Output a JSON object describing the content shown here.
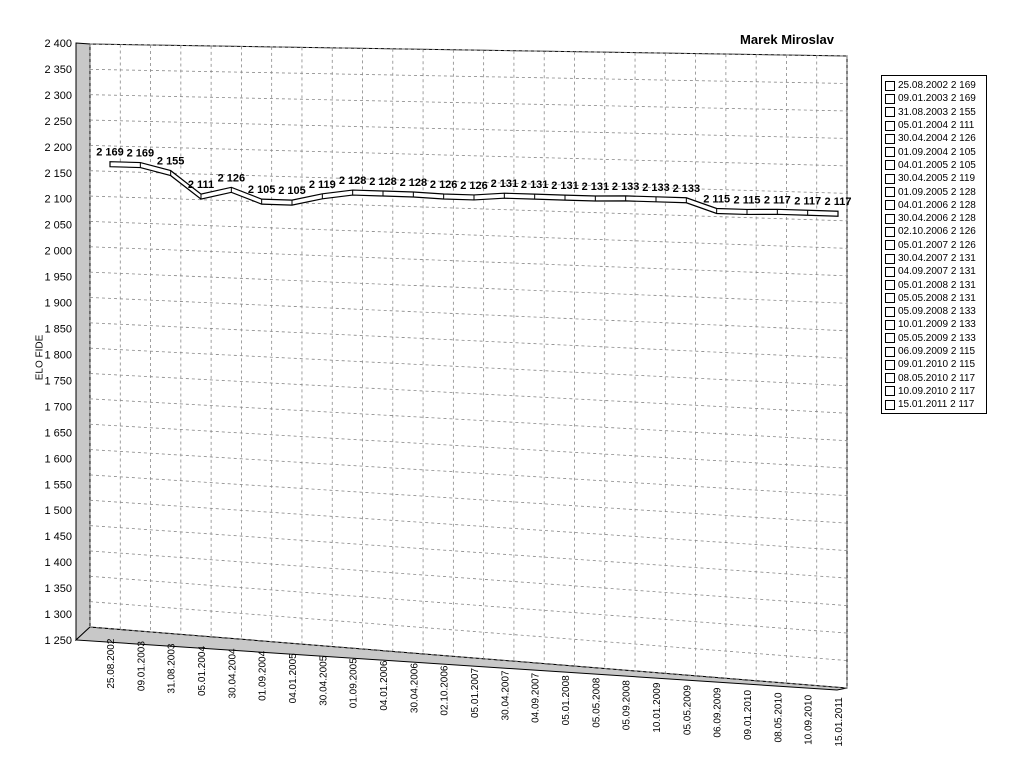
{
  "chart_data": {
    "type": "line",
    "title": "Marek Miroslav",
    "ylabel": "ELO FIDE",
    "xlabel": "",
    "ylim": [
      1250,
      2400
    ],
    "yticks": [
      "2 400",
      "2 350",
      "2 300",
      "2 250",
      "2 200",
      "2 150",
      "2 100",
      "2 050",
      "2 000",
      "1 950",
      "1 900",
      "1 850",
      "1 800",
      "1 750",
      "1 700",
      "1 650",
      "1 600",
      "1 550",
      "1 500",
      "1 450",
      "1 400",
      "1 350",
      "1 300",
      "1 250"
    ],
    "grid": true,
    "legend_position": "right",
    "categories": [
      "25.08.2002",
      "09.01.2003",
      "31.08.2003",
      "05.01.2004",
      "30.04.2004",
      "01.09.2004",
      "04.01.2005",
      "30.04.2005",
      "01.09.2005",
      "04.01.2006",
      "30.04.2006",
      "02.10.2006",
      "05.01.2007",
      "30.04.2007",
      "04.09.2007",
      "05.01.2008",
      "05.05.2008",
      "05.09.2008",
      "10.01.2009",
      "05.05.2009",
      "06.09.2009",
      "09.01.2010",
      "08.05.2010",
      "10.09.2010",
      "15.01.2011"
    ],
    "values": [
      2169,
      2169,
      2155,
      2111,
      2126,
      2105,
      2105,
      2119,
      2128,
      2128,
      2128,
      2126,
      2126,
      2131,
      2131,
      2131,
      2131,
      2133,
      2133,
      2133,
      2115,
      2115,
      2117,
      2117,
      2117
    ],
    "data_labels": [
      "2 169",
      "2 169",
      "2 155",
      "2 111",
      "2 126",
      "2 105",
      "2 105",
      "2 119",
      "2 128",
      "2 128",
      "2 128",
      "2 126",
      "2 126",
      "2 131",
      "2 131",
      "2 131",
      "2 131",
      "2 133",
      "2 133",
      "2 133",
      "2 115",
      "2 115",
      "2 117",
      "2 117",
      "2 117"
    ],
    "legend": [
      "25.08.2002 2 169",
      "09.01.2003 2 169",
      "31.08.2003 2 155",
      "05.01.2004 2 111",
      "30.04.2004 2 126",
      "01.09.2004 2 105",
      "04.01.2005 2 105",
      "30.04.2005 2 119",
      "01.09.2005 2 128",
      "04.01.2006 2 128",
      "30.04.2006 2 128",
      "02.10.2006 2 126",
      "05.01.2007 2 126",
      "30.04.2007 2 131",
      "04.09.2007 2 131",
      "05.01.2008 2 131",
      "05.05.2008 2 131",
      "05.09.2008 2 133",
      "10.01.2009 2 133",
      "05.05.2009 2 133",
      "06.09.2009 2 115",
      "09.01.2010 2 115",
      "08.05.2010 2 117",
      "10.09.2010 2 117",
      "15.01.2011 2 117"
    ]
  }
}
